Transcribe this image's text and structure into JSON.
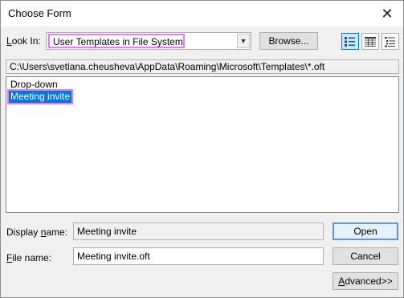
{
  "window": {
    "title": "Choose Form",
    "close_glyph": "✕"
  },
  "look_in": {
    "label_accel": "L",
    "label_rest": "ook In:",
    "value": "User Templates in File System",
    "browse_label": "Browse...",
    "dropdown_glyph": "▼"
  },
  "path": "C:\\Users\\svetlana.cheusheva\\AppData\\Roaming\\Microsoft\\Templates\\*.oft",
  "list": {
    "items": [
      "Drop-down",
      "Meeting invite"
    ],
    "selected_index": 1
  },
  "display_name": {
    "label_pre": "Display ",
    "label_accel": "n",
    "label_post": "ame:",
    "value": "Meeting invite"
  },
  "file_name": {
    "label_accel": "F",
    "label_rest": "ile name:",
    "value": "Meeting invite.oft"
  },
  "buttons": {
    "open": "Open",
    "cancel": "Cancel",
    "advanced_accel": "A",
    "advanced_rest": "dvanced>>"
  },
  "icons": {
    "close": "close-icon",
    "dropdown": "chevron-down-icon",
    "large_icons": "large-icons-view-icon",
    "small_icons": "small-icons-view-icon",
    "details": "details-view-icon"
  },
  "colors": {
    "selection": "#0078d7",
    "highlight_outline": "#e879f9",
    "default_button_border": "#5b9bd5"
  }
}
